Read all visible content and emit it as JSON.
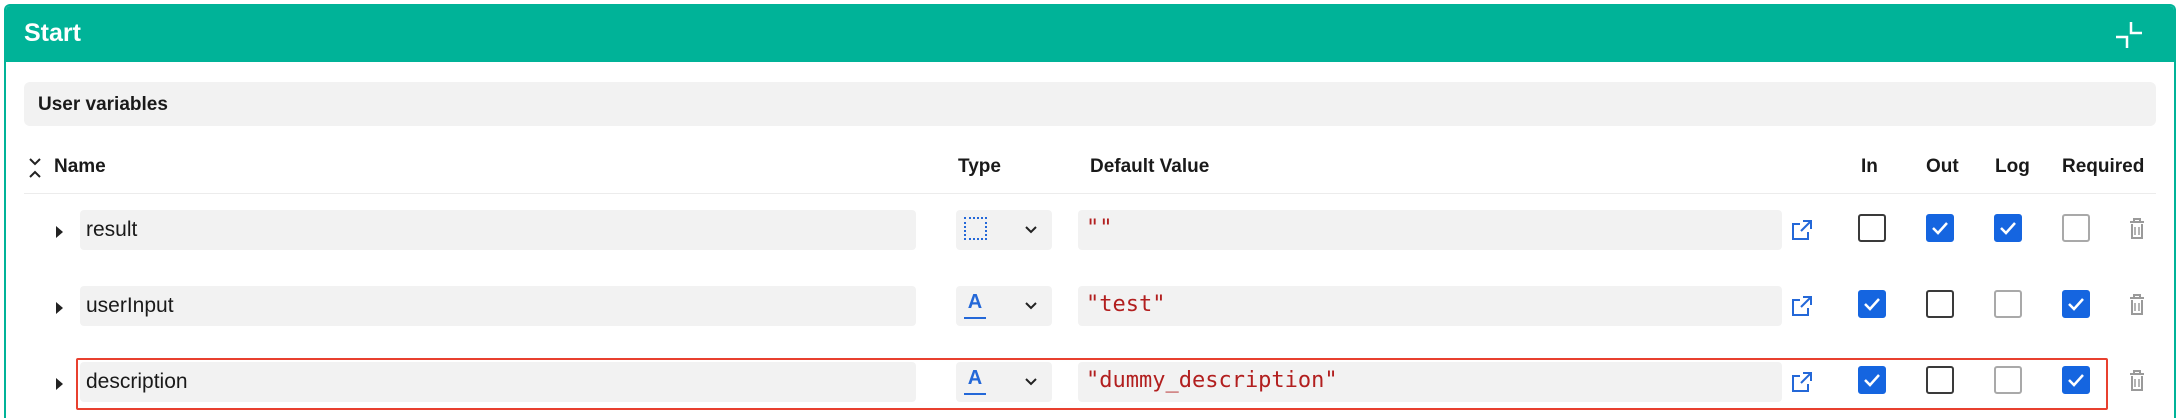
{
  "panel": {
    "title": "Start"
  },
  "section": {
    "title": "User variables"
  },
  "columns": {
    "name": "Name",
    "type": "Type",
    "default_value": "Default Value",
    "in": "In",
    "out": "Out",
    "log": "Log",
    "required": "Required"
  },
  "variables": [
    {
      "name": "result",
      "type_icon": "any-type-icon",
      "default_value": "\"\"",
      "in": false,
      "out": true,
      "log": true,
      "required": false,
      "required_style": "disabled"
    },
    {
      "name": "userInput",
      "type_icon": "text-type-icon",
      "type_glyph": "A",
      "default_value": "\"test\"",
      "in": true,
      "out": false,
      "log": false,
      "log_style": "disabled",
      "required": true
    },
    {
      "name": "description",
      "type_icon": "text-type-icon",
      "type_glyph": "A",
      "default_value": "\"dummy_description\"",
      "in": true,
      "out": false,
      "log": false,
      "log_style": "disabled",
      "required": true,
      "highlighted": true
    }
  ],
  "colors": {
    "header": "#00B398",
    "checkbox_checked": "#1565e0",
    "type_icon": "#2468d8",
    "string_value": "#b21f1f",
    "highlight_border": "#e8402f"
  }
}
